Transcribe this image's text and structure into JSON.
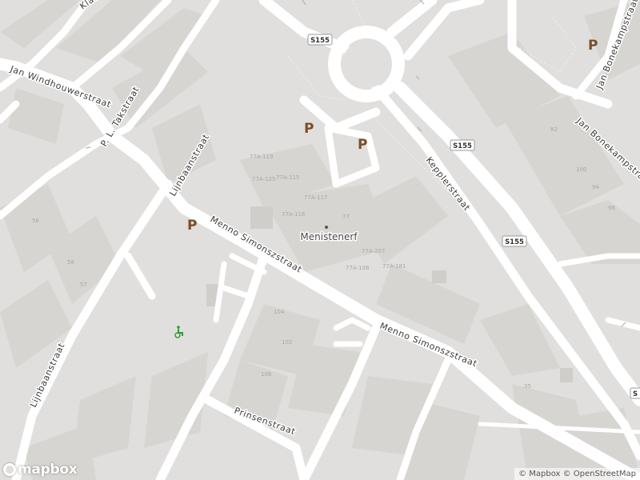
{
  "poi": {
    "name": "Menistenerf"
  },
  "streets": {
    "klaas": "Klaas",
    "jan_windhouwerstraat": "Jan Windhouwerstraat",
    "pl_takstraat": "P. L. Takstraat",
    "lijnbaanstraat_n": "Lijnbaanstraat",
    "lijnbaanstraat_s": "Lijnbaanstraat",
    "menno_simonszstraat_w": "Menno Simonszstraat",
    "menno_simonszstraat_e": "Menno Simonszstraat",
    "prinsenstraat": "Prinsenstraat",
    "kepplerstraat": "Kepplerstraat",
    "jan_bonekampstraat": "Jan Bonekampstraat",
    "jan_bonekampstraat_2": "Jan Bonekampstraat"
  },
  "route_shields": {
    "s155_a": "S155",
    "s155_b": "S155",
    "s155_c": "S155",
    "s155_d": "S"
  },
  "parking_label": "P",
  "house_numbers": {
    "h1": "77A-119",
    "h2": "77A-125",
    "h3": "77A-115",
    "h4": "77A-117",
    "h5": "77A-116",
    "h6": "77",
    "h7": "77A-207",
    "h8": "77A-108",
    "h9": "77A-181",
    "h10": "100",
    "h11": "104",
    "h12": "98",
    "h13": "82",
    "h14": "102",
    "h15": "57",
    "h16": "56",
    "h17": "35",
    "h18": "58",
    "h19": "106",
    "h20": "94"
  },
  "attribution": {
    "mapbox": "© Mapbox",
    "osm": "© OpenStreetMap"
  },
  "logo_text": "mapbox",
  "colors": {
    "land": "#e0dfdd",
    "road": "#ffffff",
    "building": "#d4d3d0",
    "parking": "#7a4e2a",
    "wheelchair": "#2e9e2e"
  }
}
